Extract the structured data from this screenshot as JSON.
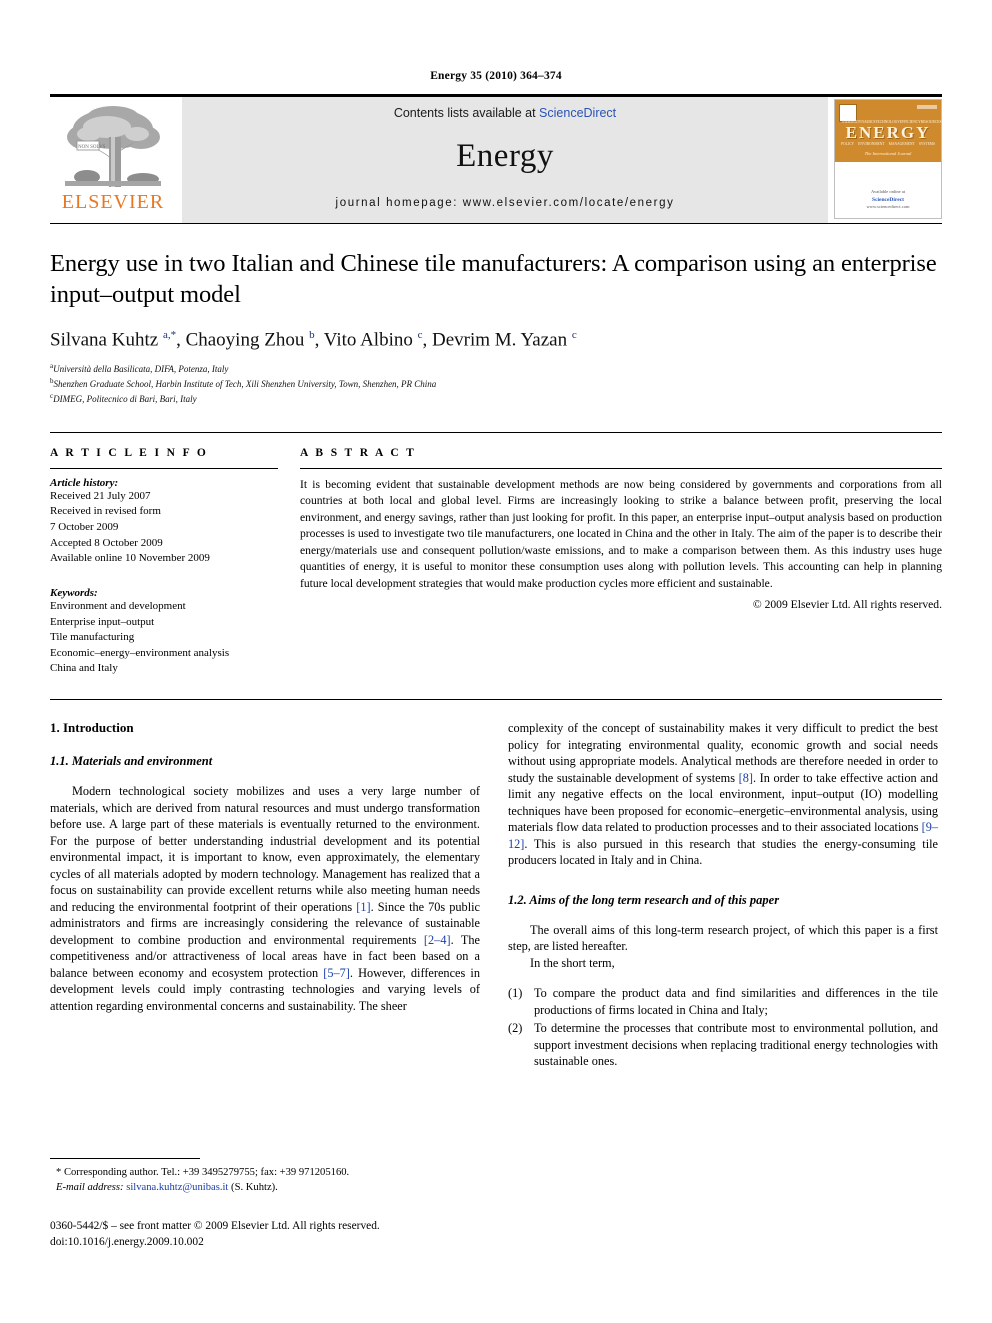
{
  "running_head": "Energy 35 (2010) 364–374",
  "masthead": {
    "publisher_logo_label": "ELSEVIER",
    "contents_prefix": "Contents lists available at ",
    "contents_link": "ScienceDirect",
    "journal_name": "Energy",
    "journal_homepage": "journal homepage: www.elsevier.com/locate/energy",
    "cover": {
      "title_word": "ENERGY",
      "subtitle": "The International Journal",
      "tiny_row1": [
        "THERMODYNAMICS",
        "TECHNOLOGY",
        "EFFICIENCY",
        "RESOURCES"
      ],
      "tiny_row2": [
        "POLICY",
        "ENVIRONMENT",
        "MANAGEMENT",
        "SYSTEMS"
      ],
      "footer_line1": "Available online at",
      "footer_line2": "ScienceDirect",
      "footer_line3": "www.sciencedirect.com"
    }
  },
  "article": {
    "title": "Energy use in two Italian and Chinese tile manufacturers: A comparison using an enterprise input–output model",
    "authors_html": "Silvana Kuhtz <sup>a,</sup><sup>*</sup>, Chaoying Zhou <sup>b</sup>, Vito Albino <sup>c</sup>, Devrim M. Yazan <sup>c</sup>",
    "affiliations": [
      {
        "marker": "a",
        "text": "Università della Basilicata, DIFA, Potenza, Italy"
      },
      {
        "marker": "b",
        "text": "Shenzhen Graduate School, Harbin Institute of Tech, Xili Shenzhen University, Town, Shenzhen, PR China"
      },
      {
        "marker": "c",
        "text": "DIMEG, Politecnico di Bari, Bari, Italy"
      }
    ]
  },
  "article_info": {
    "heading": "A R T I C L E   I N F O",
    "history_label": "Article history:",
    "history": [
      "Received 21 July 2007",
      "Received in revised form",
      "7 October 2009",
      "Accepted 8 October 2009",
      "Available online 10 November 2009"
    ],
    "keywords_label": "Keywords:",
    "keywords": [
      "Environment and development",
      "Enterprise input–output",
      "Tile manufacturing",
      "Economic–energy–environment analysis",
      "China and Italy"
    ]
  },
  "abstract": {
    "heading": "A B S T R A C T",
    "text": "It is becoming evident that sustainable development methods are now being considered by governments and corporations from all countries at both local and global level. Firms are increasingly looking to strike a balance between profit, preserving the local environment, and energy savings, rather than just looking for profit. In this paper, an enterprise input–output analysis based on production processes is used to investigate two tile manufacturers, one located in China and the other in Italy. The aim of the paper is to describe their energy/materials use and consequent pollution/waste emissions, and to make a comparison between them. As this industry uses huge quantities of energy, it is useful to monitor these consumption uses along with pollution levels. This accounting can help in planning future local development strategies that would make production cycles more efficient and sustainable.",
    "copyright": "© 2009 Elsevier Ltd. All rights reserved."
  },
  "body": {
    "section_1_title": "1.  Introduction",
    "subsection_11_title": "1.1.  Materials and environment",
    "para_1_part1": "Modern technological society mobilizes and uses a very large number of materials, which are derived from natural resources and must undergo transformation before use. A large part of these materials is eventually returned to the environment. For the purpose of better understanding industrial development and its potential environmental impact, it is important to know, even approximately, the elementary cycles of all materials adopted by modern technology. Management has realized that a focus on sustainability can provide excellent returns while also meeting human needs and reducing the environmental footprint of their operations ",
    "ref_1": "[1]",
    "para_1_part2": ". Since the 70s public administrators and firms are increasingly considering the relevance of sustainable development to combine production and environmental requirements ",
    "ref_2_4": "[2–4]",
    "para_1_part3": ". The competitiveness and/or attractiveness of local areas have in fact been based on a balance between economy and ecosystem protection ",
    "ref_5_7": "[5–7]",
    "para_1_part4": ". However, differences in development levels could imply contrasting technologies and varying levels of attention regarding environmental concerns and sustainability. The sheer",
    "para_2_part1": "complexity of the concept of sustainability makes it very difficult to predict the best policy for integrating environmental quality, economic growth and social needs without using appropriate models. Analytical methods are therefore needed in order to study the sustainable development of systems ",
    "ref_8": "[8]",
    "para_2_part2": ". In order to take effective action and limit any negative effects on the local environment, input–output (IO) modelling techniques have been proposed for economic–energetic–environmental analysis, using materials flow data related to production processes and to their associated locations ",
    "ref_9_12": "[9–12]",
    "para_2_part3": ". This is also pursued in this research that studies the energy-consuming tile producers located in Italy and in China.",
    "subsection_12_title": "1.2.  Aims of the long term research and of this paper",
    "para_3": "The overall aims of this long-term research project, of which this paper is a first step, are listed hereafter.",
    "para_4": "In the short term,",
    "aims": [
      {
        "num": "(1)",
        "text": "To compare the product data and find similarities and differences in the tile productions of firms located in China and Italy;"
      },
      {
        "num": "(2)",
        "text": "To determine the processes that contribute most to environmental pollution, and support investment decisions when replacing traditional energy technologies with sustainable ones."
      }
    ]
  },
  "footnote": {
    "corresponding": "* Corresponding author. Tel.: +39 3495279755; fax: +39 971205160.",
    "email_label": "E-mail address:",
    "email": "silvana.kuhtz@unibas.it",
    "email_suffix": "(S. Kuhtz)."
  },
  "issn": {
    "line1": "0360-5442/$ – see front matter © 2009 Elsevier Ltd. All rights reserved.",
    "line2": "doi:10.1016/j.energy.2009.10.002"
  },
  "colors": {
    "elsevier_orange": "#E87722",
    "link_blue": "#2a53b5",
    "reference_blue": "#1a3faa",
    "masthead_gray": "#e6e6e6",
    "cover_orange": "#d08a2e"
  }
}
